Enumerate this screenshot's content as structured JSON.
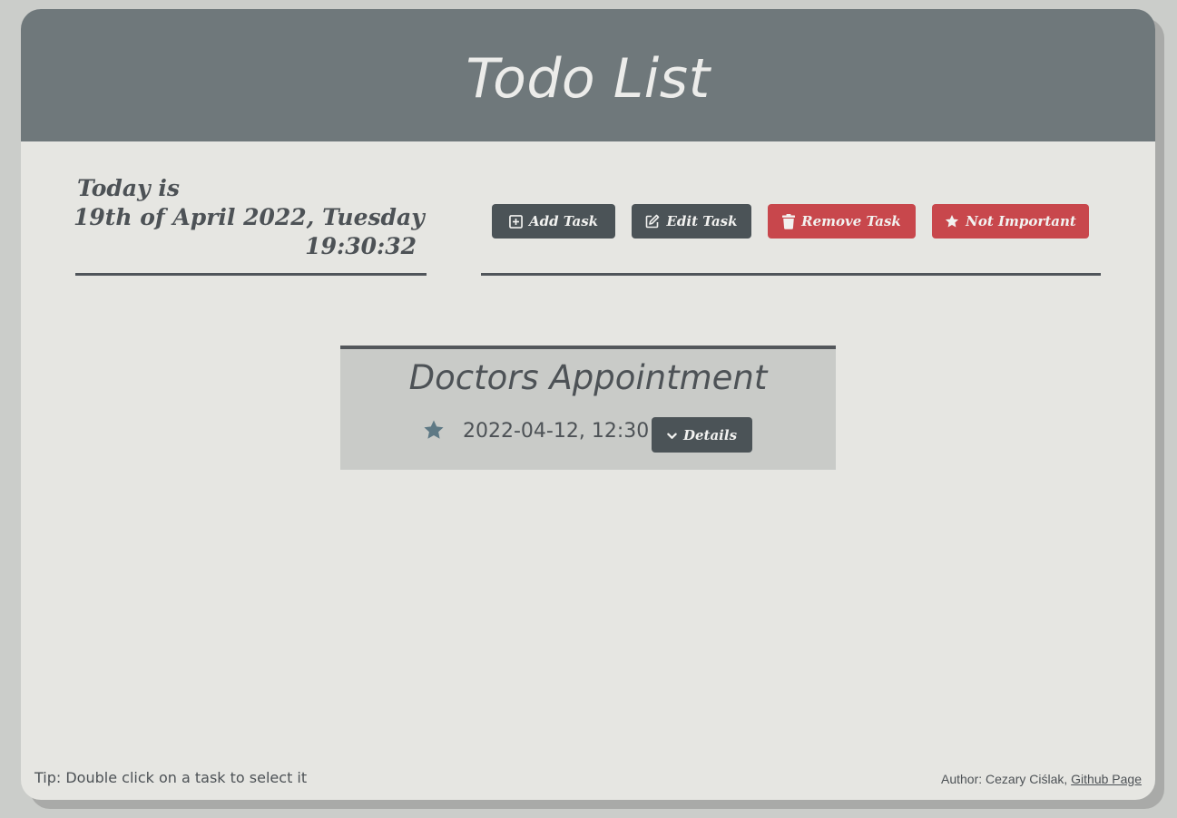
{
  "header": {
    "title": "Todo List"
  },
  "date": {
    "line1": "Today is",
    "line2": "19th of April 2022, Tuesday",
    "time": "19:30:32"
  },
  "toolbar": {
    "add_label": "Add Task",
    "add_icon": "plus-square-icon",
    "edit_label": "Edit Task",
    "edit_icon": "edit-icon",
    "remove_label": "Remove Task",
    "remove_icon": "trash-icon",
    "important_label": "Not Important",
    "important_icon": "star-icon"
  },
  "tasks": [
    {
      "title": "Doctors Appointment",
      "datetime": "2022-04-12, 12:30",
      "details_label": "Details",
      "star_icon": "star-icon",
      "details_icon": "chevron-down-icon"
    }
  ],
  "footer": {
    "tip": "Tip: Double click on a task to select it",
    "author_prefix": "Author: Cezary Ciślak,",
    "github_link": "Github Page"
  },
  "colors": {
    "header_bg": "#6f787b",
    "page_bg": "#e6e6e2",
    "dark_button": "#4b5357",
    "red_button": "#c8474c",
    "task_bg": "#c9cbc8",
    "star_color": "#5e7985"
  }
}
